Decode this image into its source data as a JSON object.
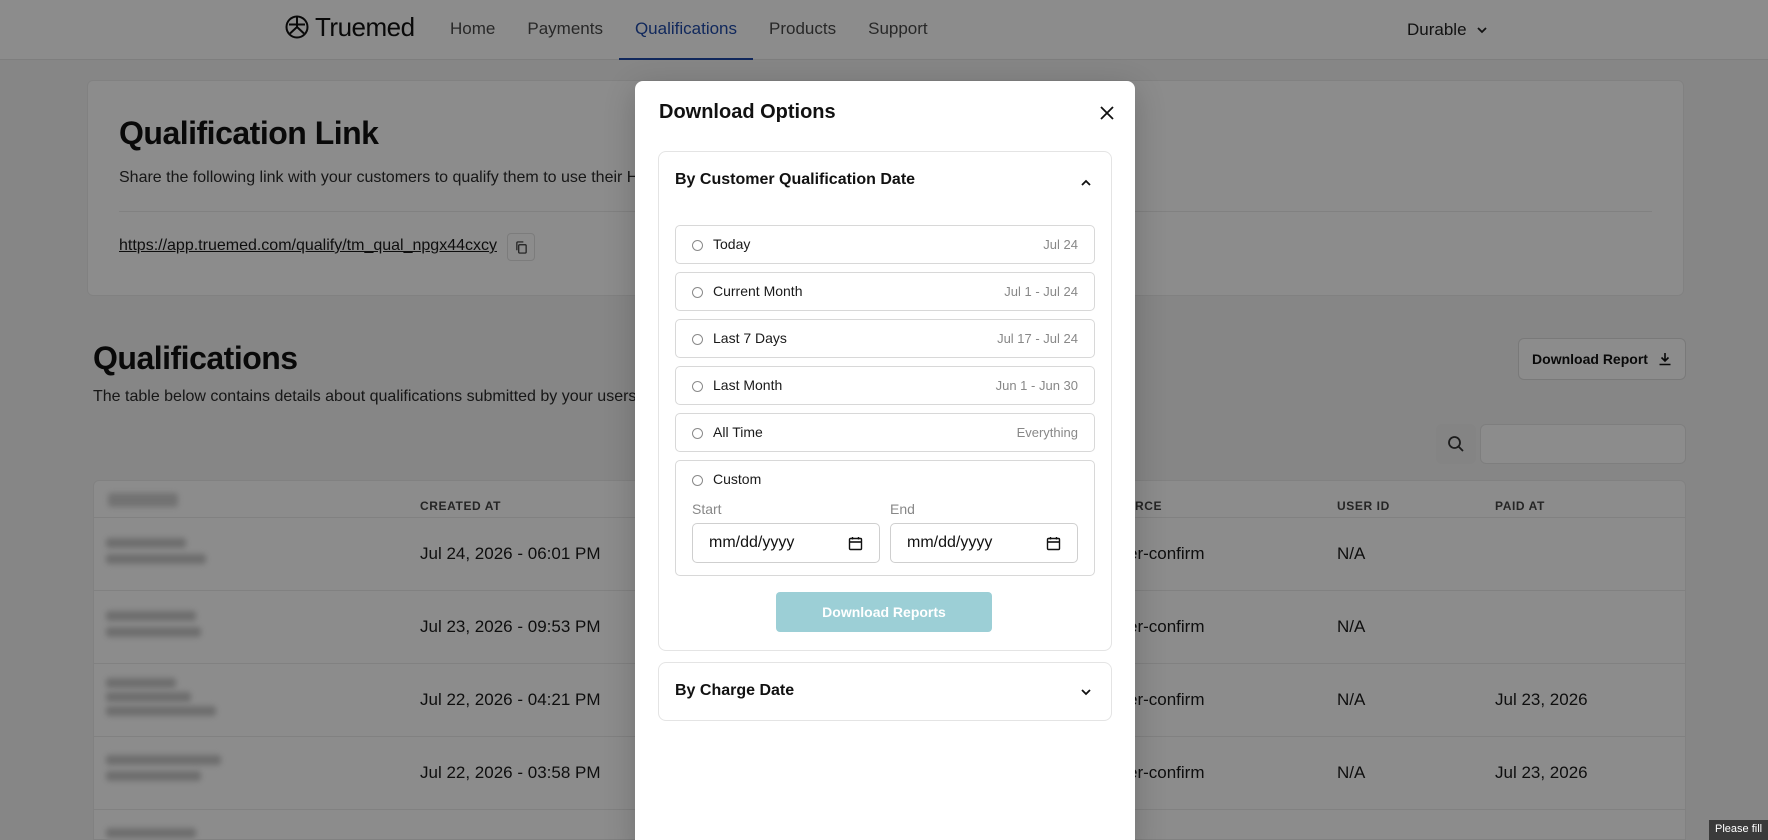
{
  "nav": {
    "brand": "Truemed",
    "links": [
      "Home",
      "Payments",
      "Qualifications",
      "Products",
      "Support"
    ],
    "active": "Qualifications",
    "org": "Durable"
  },
  "link_card": {
    "title": "Qualification Link",
    "description": "Share the following link with your customers to qualify them to use their HSA",
    "url": "https://app.truemed.com/qualify/tm_qual_npgx44cxcy"
  },
  "qualifications": {
    "title": "Qualifications",
    "description": "The table below contains details about qualifications submitted by your users.",
    "download_report_label": "Download Report",
    "search_placeholder": "",
    "columns": {
      "created_at": "CREATED AT",
      "source": "RCE",
      "user_id": "USER ID",
      "paid_at": "PAID AT"
    },
    "rows": [
      {
        "created_at": "Jul 24, 2026 - 06:01 PM",
        "source": "er-confirm",
        "user_id": "N/A",
        "paid_at": ""
      },
      {
        "created_at": "Jul 23, 2026 - 09:53 PM",
        "source": "er-confirm",
        "user_id": "N/A",
        "paid_at": ""
      },
      {
        "created_at": "Jul 22, 2026 - 04:21 PM",
        "source": "er-confirm",
        "user_id": "N/A",
        "paid_at": "Jul 23, 2026"
      },
      {
        "created_at": "Jul 22, 2026 - 03:58 PM",
        "source": "er-confirm",
        "user_id": "N/A",
        "paid_at": "Jul 23, 2026"
      }
    ]
  },
  "modal": {
    "title": "Download Options",
    "section1": {
      "title": "By Customer Qualification Date",
      "options": [
        {
          "label": "Today",
          "range": "Jul 24"
        },
        {
          "label": "Current Month",
          "range": "Jul 1 - Jul 24"
        },
        {
          "label": "Last 7 Days",
          "range": "Jul 17 - Jul 24"
        },
        {
          "label": "Last Month",
          "range": "Jun 1 - Jun 30"
        },
        {
          "label": "All Time",
          "range": "Everything"
        }
      ],
      "custom": {
        "label": "Custom",
        "start_label": "Start",
        "end_label": "End",
        "start_value": "mm/dd/yyyy",
        "end_value": "mm/dd/yyyy"
      },
      "button": "Download Reports"
    },
    "section2": {
      "title": "By Charge Date"
    }
  },
  "tooltip": "Please fill",
  "colors": {
    "accent": "#1f4aa8",
    "button_disabled": "#9ccfd6"
  }
}
